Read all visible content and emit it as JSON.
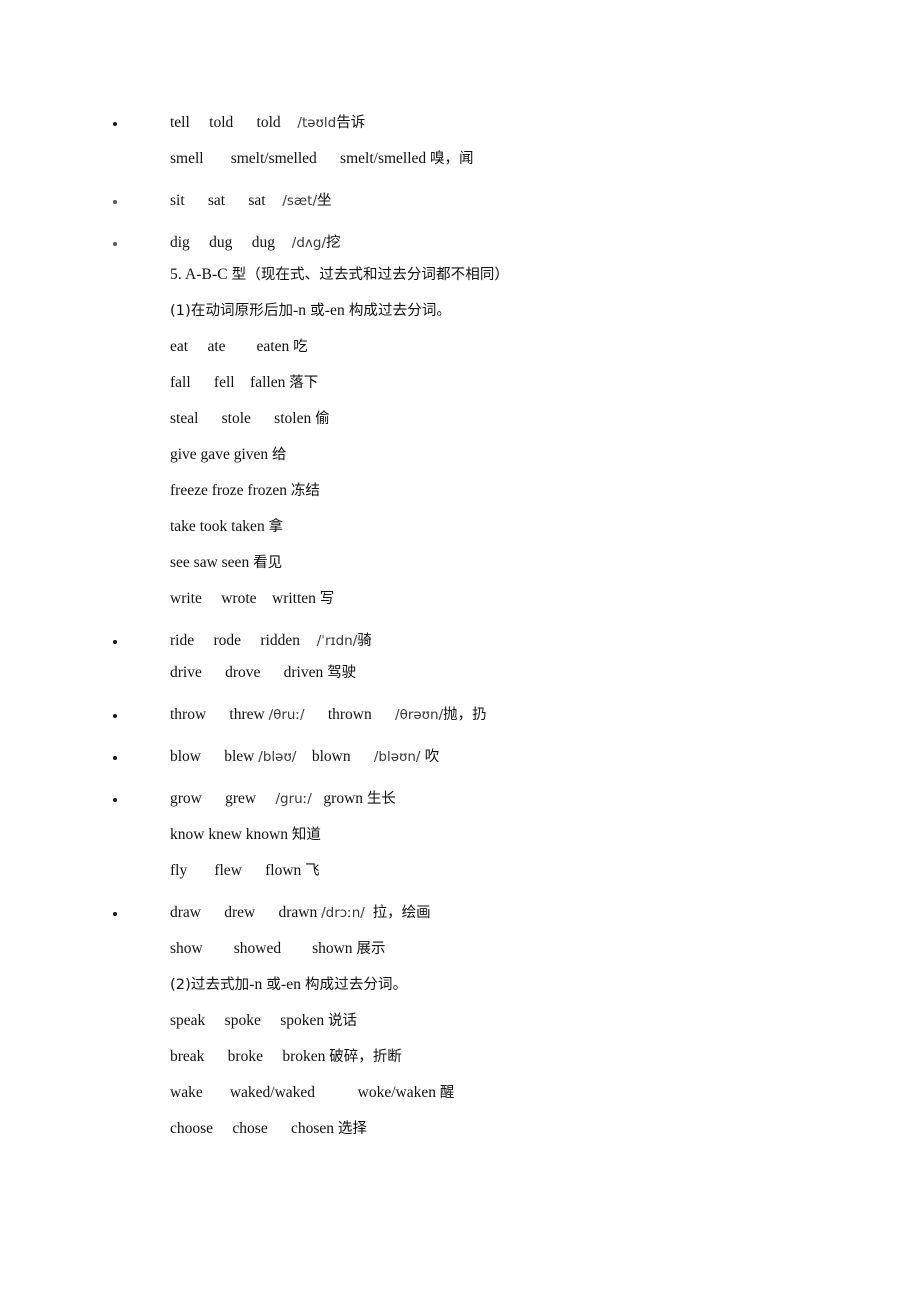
{
  "document": {
    "page_background": "#ffffff",
    "text_color": "#111111",
    "ipa_color": "#3a3a3a",
    "blocks": [
      {
        "bullet": true,
        "bullet_style": "dark",
        "gap": "none",
        "rows": [
          {
            "bulleted": true,
            "gap": "none",
            "en": "tell     told      told ",
            "cn": "告诉",
            "ipa": "   /təʊld"
          },
          {
            "bulleted": false,
            "gap": "md",
            "en": "smell       smelt/smelled      smelt/smelled ",
            "cn": "嗅，闻",
            "ipa": ""
          }
        ]
      },
      {
        "bullet": true,
        "bullet_style": "faint",
        "gap": "lg",
        "rows": [
          {
            "bulleted": true,
            "gap": "none",
            "en": "sit      sat      sat ",
            "cn": "坐",
            "ipa": "   /sæt/"
          }
        ]
      },
      {
        "bullet": true,
        "bullet_style": "faint",
        "gap": "lg",
        "rows": [
          {
            "bulleted": true,
            "gap": "none",
            "en": "dig     dug     dug ",
            "cn": "挖",
            "ipa": "   /dʌg/"
          }
        ]
      },
      {
        "bullet": false,
        "gap": "sm",
        "rows": [
          {
            "bulleted": false,
            "gap": "none",
            "heading": true,
            "en": "5. A-B-C ",
            "cn": "型（现在式、过去式和过去分词都不相同）",
            "ipa": ""
          },
          {
            "bulleted": false,
            "gap": "md",
            "heading": true,
            "cn_pre": "(1)在动词原形后加",
            "en": "-n ",
            "cn_mid": "或",
            "en2": "-en ",
            "cn": "构成过去分词。",
            "ipa": ""
          },
          {
            "bulleted": false,
            "gap": "md",
            "en": "eat     ate        eaten ",
            "cn": "吃",
            "ipa": ""
          },
          {
            "bulleted": false,
            "gap": "md",
            "en": "fall      fell    fallen ",
            "cn": "落下",
            "ipa": ""
          },
          {
            "bulleted": false,
            "gap": "md",
            "en": "steal      stole      stolen ",
            "cn": "偷",
            "ipa": ""
          },
          {
            "bulleted": false,
            "gap": "md",
            "en": "give gave given ",
            "cn": "给",
            "ipa": ""
          },
          {
            "bulleted": false,
            "gap": "md",
            "en": "freeze froze frozen ",
            "cn": "冻结",
            "ipa": ""
          },
          {
            "bulleted": false,
            "gap": "md",
            "en": "take took taken ",
            "cn": "拿",
            "ipa": ""
          },
          {
            "bulleted": false,
            "gap": "md",
            "en": "see saw seen ",
            "cn": "看见",
            "ipa": ""
          },
          {
            "bulleted": false,
            "gap": "md",
            "en": "write     wrote    written ",
            "cn": "写",
            "ipa": ""
          }
        ]
      },
      {
        "bullet": true,
        "bullet_style": "dark",
        "gap": "lg",
        "rows": [
          {
            "bulleted": true,
            "gap": "none",
            "en": "ride     rode     ridden ",
            "cn": "骑",
            "ipa": "   /ˈrɪdn/"
          },
          {
            "bulleted": false,
            "gap": "sm",
            "en": "drive      drove      driven ",
            "cn": "驾驶",
            "ipa": ""
          }
        ]
      },
      {
        "bullet": true,
        "bullet_style": "dark",
        "gap": "lg",
        "rows": [
          {
            "bulleted": true,
            "gap": "none",
            "en": "throw      threw ",
            "ipa_mid": "/θruː/",
            "en2": "      thrown      ",
            "ipa": "/θrəʊn/",
            "cn": "抛，扔"
          }
        ]
      },
      {
        "bullet": true,
        "bullet_style": "dark",
        "gap": "lg",
        "rows": [
          {
            "bulleted": true,
            "gap": "none",
            "en": "blow      blew ",
            "ipa_mid": "/bləʊ/",
            "en2": "    blown      ",
            "ipa": "/bləʊn/ ",
            "cn": "吹"
          }
        ]
      },
      {
        "bullet": true,
        "bullet_style": "dark",
        "gap": "lg",
        "rows": [
          {
            "bulleted": true,
            "gap": "none",
            "en": "grow      grew     ",
            "ipa_mid": "/gruː/",
            "en2": "   grown ",
            "cn": "生长"
          },
          {
            "bulleted": false,
            "gap": "md",
            "en": "know knew known ",
            "cn": "知道",
            "ipa": ""
          },
          {
            "bulleted": false,
            "gap": "md",
            "en": "fly       flew      flown ",
            "cn": "飞",
            "ipa": ""
          }
        ]
      },
      {
        "bullet": true,
        "bullet_style": "dark",
        "gap": "lg",
        "rows": [
          {
            "bulleted": true,
            "gap": "none",
            "en": "draw      drew      drawn ",
            "ipa_mid": "/drɔːn/",
            "en2": "  ",
            "cn": "拉，绘画"
          },
          {
            "bulleted": false,
            "gap": "md",
            "en": "show        showed        shown ",
            "cn": "展示",
            "ipa": ""
          },
          {
            "bulleted": false,
            "gap": "md",
            "heading": true,
            "cn_pre": "(2)过去式加",
            "en": "-n ",
            "cn_mid": "或",
            "en2": "-en ",
            "cn": "构成过去分词。",
            "ipa": ""
          },
          {
            "bulleted": false,
            "gap": "md",
            "en": "speak     spoke     spoken ",
            "cn": "说话",
            "ipa": ""
          },
          {
            "bulleted": false,
            "gap": "md",
            "en": "break      broke     broken ",
            "cn": "破碎，折断",
            "ipa": ""
          },
          {
            "bulleted": false,
            "gap": "md",
            "en": "wake       waked/waked           woke/waken ",
            "cn": "醒",
            "ipa": ""
          },
          {
            "bulleted": false,
            "gap": "md",
            "en": "choose     chose      chosen ",
            "cn": "选择",
            "ipa": ""
          }
        ]
      }
    ]
  }
}
